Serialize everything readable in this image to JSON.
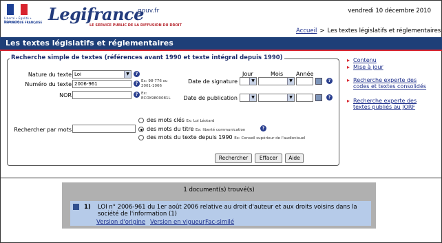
{
  "header": {
    "republique_motto": "Liberté • Égalité • Fraternité",
    "republique_name": "RÉPUBLIQUE FRANÇAISE",
    "site_name": "Legifrance",
    "site_domain": ".gouv.fr",
    "tagline": "LE SERVICE PUBLIC DE LA DIFFUSION DU DROIT",
    "date": "vendredi 10 décembre 2010"
  },
  "breadcrumb": {
    "home": "Accueil",
    "separator": ">",
    "current": "Les textes législatifs et réglementaires"
  },
  "page_title": "Les textes législatifs et réglementaires",
  "search": {
    "legend": "Recherche simple de textes (références avant 1990 et texte intégral depuis 1990)",
    "nature_label": "Nature du texte",
    "nature_value": "Loi",
    "numero_label": "Numéro du texte",
    "numero_value": "2006-961",
    "numero_hint_1": "Ex: 98-776 ou",
    "numero_hint_2": "2001-1066",
    "nor_label": "NOR",
    "nor_value": "",
    "nor_hint_1": "Ex:",
    "nor_hint_2": "ECOX9800081L",
    "col_jour": "Jour",
    "col_mois": "Mois",
    "col_annee": "Année",
    "signature_label": "Date de signature",
    "publication_label": "Date de publication",
    "mots_label": "Rechercher par mots",
    "mots_value": "",
    "opt1": "des mots clés",
    "opt1_ex": "Ex: Loi Léotard",
    "opt2": "des mots du titre",
    "opt2_ex": "Ex: liberté communication",
    "opt3": "des mots du texte depuis 1990",
    "opt3_ex": "Ex: Conseil supérieur de l'audiovisuel",
    "btn_search": "Rechercher",
    "btn_clear": "Effacer",
    "btn_help": "Aide"
  },
  "right_menu": {
    "contenu": "Contenu",
    "maj": "Mise à jour",
    "expert1_l1": "Recherche experte des",
    "expert1_l2": "codes et textes consolidés",
    "expert2_l1": "Recherche experte des",
    "expert2_l2": "textes publiés au JORF"
  },
  "results": {
    "count": "1 document(s) trouvé(s)",
    "item_number": "1)",
    "item_text": "LOI n° 2006-961 du 1er août 2006 relative au droit d'auteur et aux droits voisins dans la société de l'information (1)",
    "link_original": "Version d'origine",
    "link_current": "Version en vigueur",
    "link_facsimile": "Fac-similé"
  },
  "colors": {
    "title_bar": "#1e3f78",
    "accent_red": "#d8242e",
    "link": "#1a2c8a",
    "result_bg": "#b0b0b0",
    "result_item_bg": "#b6cbe9"
  },
  "icons": [
    "help-icon",
    "calendar-icon",
    "dropdown-arrow-icon",
    "document-icon",
    "flag-logo"
  ]
}
